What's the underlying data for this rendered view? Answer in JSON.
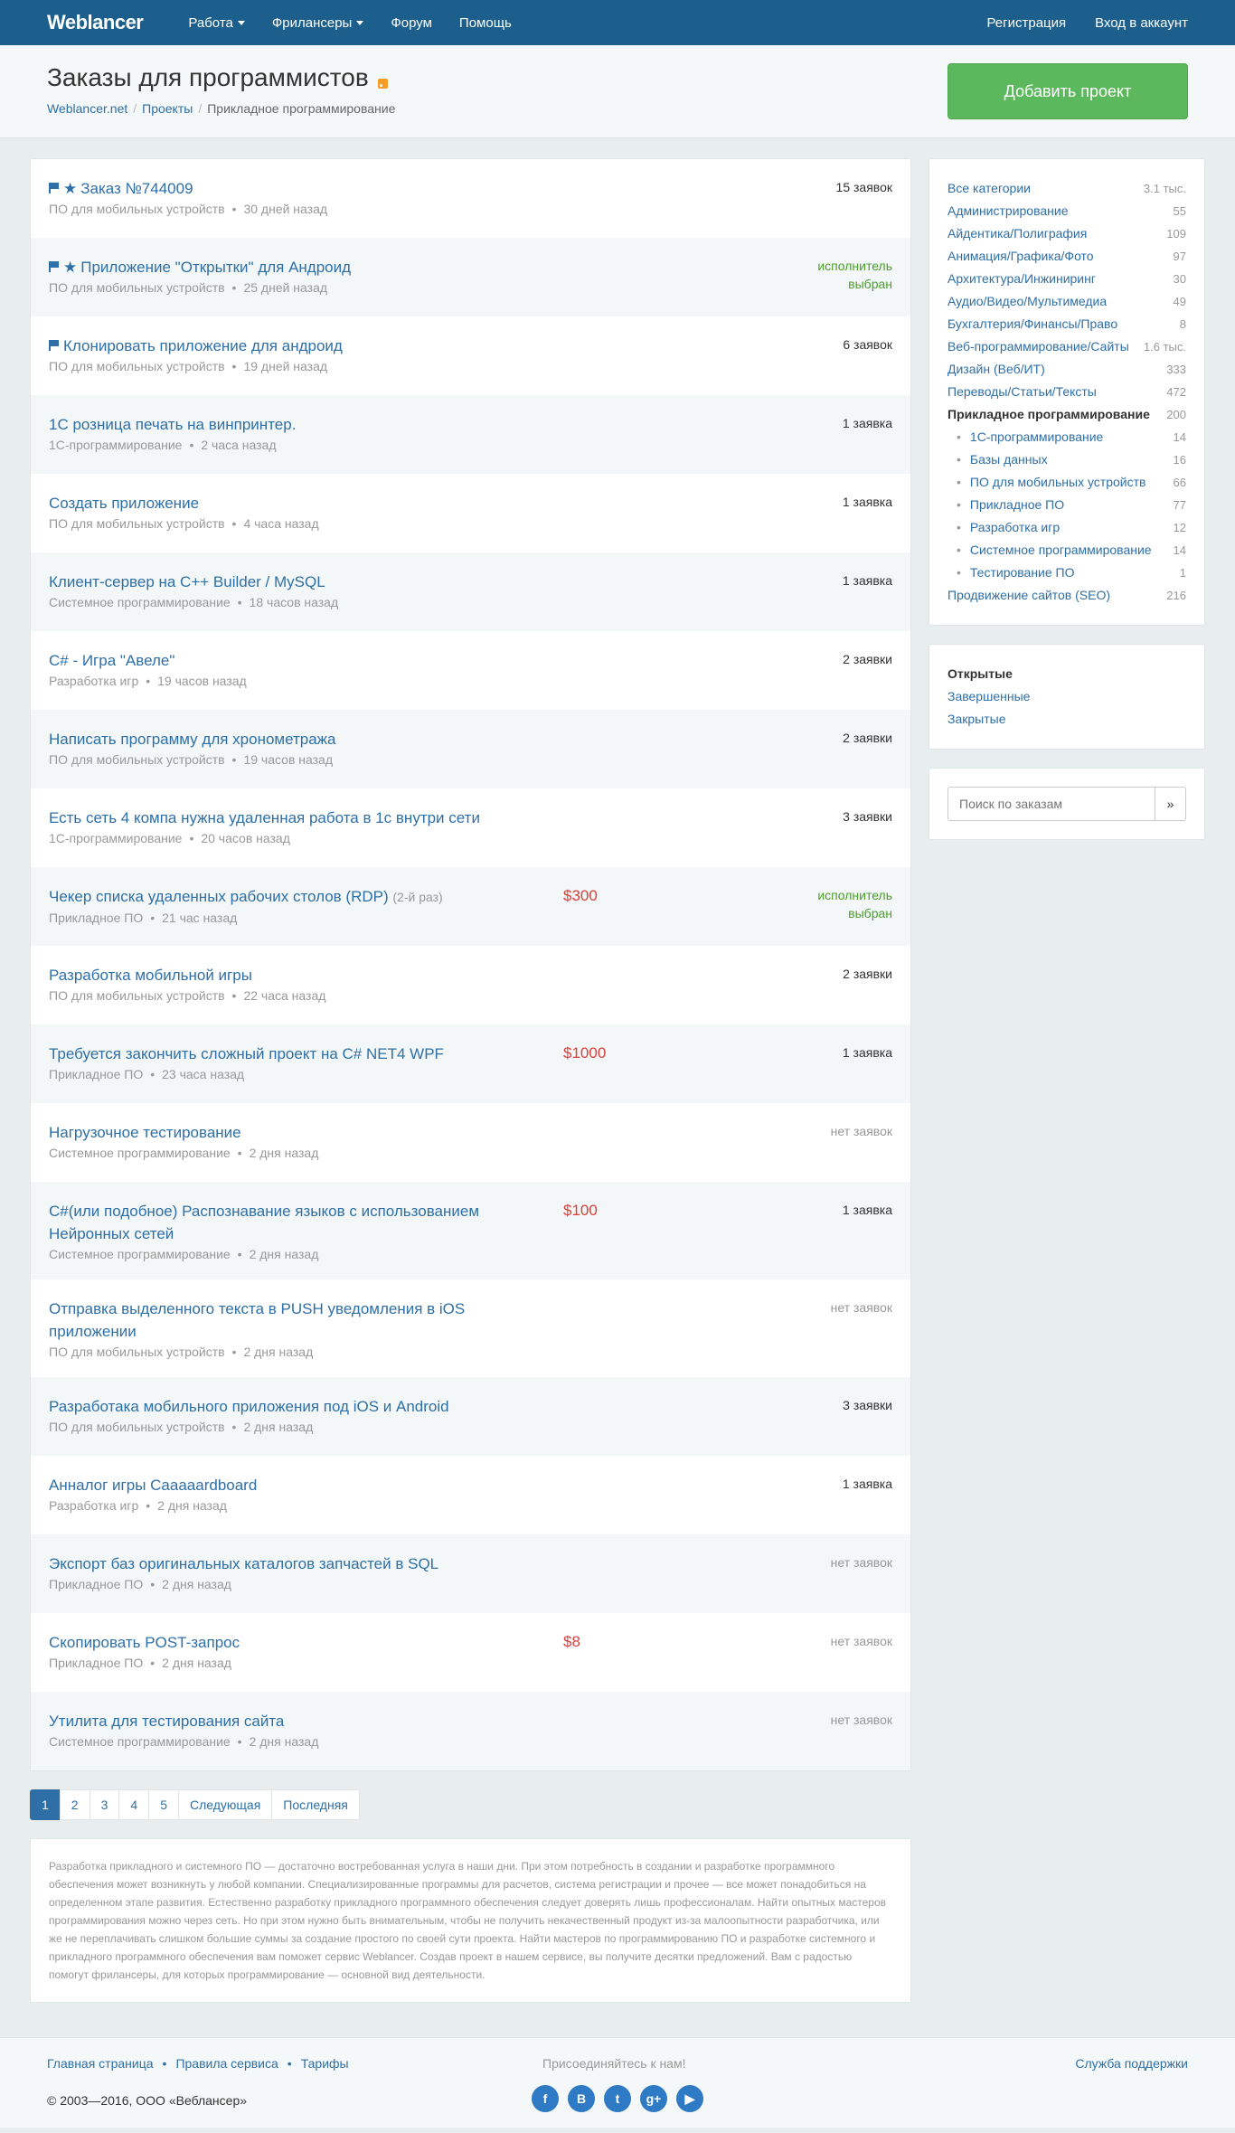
{
  "nav": {
    "logo": "Weblancer",
    "items": [
      "Работа",
      "Фрилансеры",
      "Форум",
      "Помощь"
    ],
    "register": "Регистрация",
    "login": "Вход в аккаунт"
  },
  "header": {
    "title": "Заказы для программистов",
    "breadcrumb": [
      "Weblancer.net",
      "Проекты",
      "Прикладное программирование"
    ],
    "add_project": "Добавить проект"
  },
  "orders": [
    {
      "flag": true,
      "star": true,
      "title": "Заказ №744009",
      "category": "ПО для мобильных устройств",
      "time": "30 дней назад",
      "price": "",
      "bids": "15 заявок",
      "bids_type": "normal"
    },
    {
      "flag": true,
      "star": true,
      "title": "Приложение \"Открытки\" для Андроид",
      "category": "ПО для мобильных устройств",
      "time": "25 дней назад",
      "price": "",
      "bids": "исполнитель выбран",
      "bids_type": "chosen"
    },
    {
      "flag": true,
      "star": false,
      "title": "Клонировать приложение для андроид",
      "category": "ПО для мобильных устройств",
      "time": "19 дней назад",
      "price": "",
      "bids": "6 заявок",
      "bids_type": "normal"
    },
    {
      "flag": false,
      "star": false,
      "title": "1С розница печать на винпринтер.",
      "category": "1С-программирование",
      "time": "2 часа назад",
      "price": "",
      "bids": "1 заявка",
      "bids_type": "normal"
    },
    {
      "flag": false,
      "star": false,
      "title": "Создать приложение",
      "category": "ПО для мобильных устройств",
      "time": "4 часа назад",
      "price": "",
      "bids": "1 заявка",
      "bids_type": "normal"
    },
    {
      "flag": false,
      "star": false,
      "title": "Клиент-сервер на C++ Builder / MySQL",
      "category": "Системное программирование",
      "time": "18 часов назад",
      "price": "",
      "bids": "1 заявка",
      "bids_type": "normal"
    },
    {
      "flag": false,
      "star": false,
      "title": "C# - Игра \"Авеле\"",
      "category": "Разработка игр",
      "time": "19 часов назад",
      "price": "",
      "bids": "2 заявки",
      "bids_type": "normal"
    },
    {
      "flag": false,
      "star": false,
      "title": "Написать программу для хронометража",
      "category": "ПО для мобильных устройств",
      "time": "19 часов назад",
      "price": "",
      "bids": "2 заявки",
      "bids_type": "normal"
    },
    {
      "flag": false,
      "star": false,
      "title": "Есть сеть 4 компа нужна удаленная работа в 1с внутри сети",
      "category": "1С-программирование",
      "time": "20 часов назад",
      "price": "",
      "bids": "3 заявки",
      "bids_type": "normal"
    },
    {
      "flag": false,
      "star": false,
      "title": "Чекер списка удаленных рабочих столов (RDP)",
      "suffix": "(2-й раз)",
      "category": "Прикладное ПО",
      "time": "21 час назад",
      "price": "$300",
      "bids": "исполнитель выбран",
      "bids_type": "chosen"
    },
    {
      "flag": false,
      "star": false,
      "title": "Разработка мобильной игры",
      "category": "ПО для мобильных устройств",
      "time": "22 часа назад",
      "price": "",
      "bids": "2 заявки",
      "bids_type": "normal"
    },
    {
      "flag": false,
      "star": false,
      "title": "Требуется закончить сложный проект на C# NET4 WPF",
      "category": "Прикладное ПО",
      "time": "23 часа назад",
      "price": "$1000",
      "bids": "1 заявка",
      "bids_type": "normal"
    },
    {
      "flag": false,
      "star": false,
      "title": "Нагрузочное тестирование",
      "category": "Системное программирование",
      "time": "2 дня назад",
      "price": "",
      "bids": "нет заявок",
      "bids_type": "none"
    },
    {
      "flag": false,
      "star": false,
      "title": "C#(или подобное) Распознавание языков с использованием Нейронных сетей",
      "category": "Системное программирование",
      "time": "2 дня назад",
      "price": "$100",
      "bids": "1 заявка",
      "bids_type": "normal"
    },
    {
      "flag": false,
      "star": false,
      "title": "Отправка выделенного текста в PUSH уведомления в iOS приложении",
      "category": "ПО для мобильных устройств",
      "time": "2 дня назад",
      "price": "",
      "bids": "нет заявок",
      "bids_type": "none"
    },
    {
      "flag": false,
      "star": false,
      "title": "Разработака мобильного приложения под iOS и Android",
      "category": "ПО для мобильных устройств",
      "time": "2 дня назад",
      "price": "",
      "bids": "3 заявки",
      "bids_type": "normal"
    },
    {
      "flag": false,
      "star": false,
      "title": "Анналог игры Caaaaardboard",
      "category": "Разработка игр",
      "time": "2 дня назад",
      "price": "",
      "bids": "1 заявка",
      "bids_type": "normal"
    },
    {
      "flag": false,
      "star": false,
      "title": "Экспорт баз оригинальных каталогов запчастей в SQL",
      "category": "Прикладное ПО",
      "time": "2 дня назад",
      "price": "",
      "bids": "нет заявок",
      "bids_type": "none"
    },
    {
      "flag": false,
      "star": false,
      "title": "Скопировать POST-запрос",
      "category": "Прикладное ПО",
      "time": "2 дня назад",
      "price": "$8",
      "bids": "нет заявок",
      "bids_type": "none"
    },
    {
      "flag": false,
      "star": false,
      "title": "Утилита для тестирования сайта",
      "category": "Системное программирование",
      "time": "2 дня назад",
      "price": "",
      "bids": "нет заявок",
      "bids_type": "none"
    }
  ],
  "pagination": {
    "pages": [
      "1",
      "2",
      "3",
      "4",
      "5"
    ],
    "next": "Следующая",
    "last": "Последняя"
  },
  "description": "Разработка прикладного и системного ПО — достаточно востребованная услуга в наши дни. При этом потребность в создании и разработке программного обеспечения может возникнуть у любой компании. Специализированные программы для расчетов, система регистрации и прочее — все может понадобиться на определенном этапе развития. Естественно разработку прикладного программного обеспечения следует доверять лишь профессионалам. Найти опытных мастеров программирования можно через сеть. Но при этом нужно быть внимательным, чтобы не получить некачественный продукт из-за малоопытности разработчика, или же не переплачивать слишком большие суммы за создание простого по своей сути проекта. Найти мастеров по программированию ПО и разработке системного и прикладного программного обеспечения вам поможет сервис Weblancer. Создав проект в нашем сервисе, вы получите десятки предложений. Вам с радостью помогут фрилансеры, для которых программирование — основной вид деятельности.",
  "sidebar": {
    "categories": [
      {
        "name": "Все категории",
        "count": "3.1 тыс."
      },
      {
        "name": "Администрирование",
        "count": "55"
      },
      {
        "name": "Айдентика/Полиграфия",
        "count": "109"
      },
      {
        "name": "Анимация/Графика/Фото",
        "count": "97"
      },
      {
        "name": "Архитектура/Инжиниринг",
        "count": "30"
      },
      {
        "name": "Аудио/Видео/Мультимедиа",
        "count": "49"
      },
      {
        "name": "Бухгалтерия/Финансы/Право",
        "count": "8"
      },
      {
        "name": "Веб-программирование/Сайты",
        "count": "1.6 тыс."
      },
      {
        "name": "Дизайн (Веб/ИТ)",
        "count": "333"
      },
      {
        "name": "Переводы/Статьи/Тексты",
        "count": "472"
      }
    ],
    "active_category": {
      "name": "Прикладное программирование",
      "count": "200"
    },
    "subcategories": [
      {
        "name": "1С-программирование",
        "count": "14"
      },
      {
        "name": "Базы данных",
        "count": "16"
      },
      {
        "name": "ПО для мобильных устройств",
        "count": "66"
      },
      {
        "name": "Прикладное ПО",
        "count": "77"
      },
      {
        "name": "Разработка игр",
        "count": "12"
      },
      {
        "name": "Системное программирование",
        "count": "14"
      },
      {
        "name": "Тестирование ПО",
        "count": "1"
      }
    ],
    "last_category": {
      "name": "Продвижение сайтов (SEO)",
      "count": "216"
    },
    "status": {
      "current": "Открытые",
      "completed": "Завершенные",
      "closed": "Закрытые"
    },
    "search_placeholder": "Поиск по заказам",
    "search_button": "»"
  },
  "footer": {
    "links": [
      "Главная страница",
      "Правила сервиса",
      "Тарифы"
    ],
    "copyright": "© 2003—2016, ООО «Веблансер»",
    "join": "Присоединяйтесь к нам!",
    "socials": [
      {
        "icon": "facebook-icon",
        "glyph": "f"
      },
      {
        "icon": "vk-icon",
        "glyph": "В"
      },
      {
        "icon": "twitter-icon",
        "glyph": "t"
      },
      {
        "icon": "google-plus-icon",
        "glyph": "g+"
      },
      {
        "icon": "youtube-icon",
        "glyph": "▶"
      }
    ],
    "support": "Служба поддержки"
  }
}
